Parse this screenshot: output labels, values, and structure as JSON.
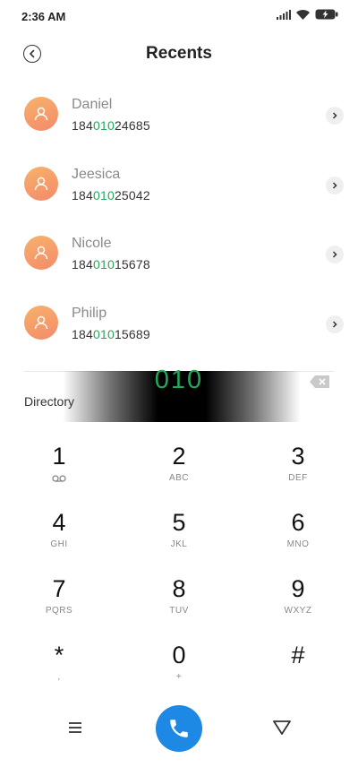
{
  "status_bar": {
    "time": "2:36 AM",
    "icons": [
      "signal-icon",
      "wifi-icon",
      "battery-charging-icon"
    ]
  },
  "header": {
    "title": "Recents",
    "back_icon": "back-circle-icon"
  },
  "recents": [
    {
      "name": "Daniel",
      "number_prefix": "184",
      "number_match": "010",
      "number_suffix": "24685"
    },
    {
      "name": "Jeesica",
      "number_prefix": "184",
      "number_match": "010",
      "number_suffix": "25042"
    },
    {
      "name": "Nicole",
      "number_prefix": "184",
      "number_match": "010",
      "number_suffix": "15678"
    },
    {
      "name": "Philip",
      "number_prefix": "184",
      "number_match": "010",
      "number_suffix": "15689"
    }
  ],
  "dialer": {
    "input": "010",
    "directory_label": "Directory",
    "match_color": "#22a85a"
  },
  "keypad": [
    {
      "digit": "1",
      "letters": "",
      "icon": "voicemail-icon"
    },
    {
      "digit": "2",
      "letters": "ABC"
    },
    {
      "digit": "3",
      "letters": "DEF"
    },
    {
      "digit": "4",
      "letters": "GHI"
    },
    {
      "digit": "5",
      "letters": "JKL"
    },
    {
      "digit": "6",
      "letters": "MNO"
    },
    {
      "digit": "7",
      "letters": "PQRS"
    },
    {
      "digit": "8",
      "letters": "TUV"
    },
    {
      "digit": "9",
      "letters": "WXYZ"
    },
    {
      "digit": "*",
      "letters": ","
    },
    {
      "digit": "0",
      "letters": "+"
    },
    {
      "digit": "#",
      "letters": ""
    }
  ],
  "bottom_bar": {
    "menu_icon": "menu-icon",
    "call_icon": "phone-icon",
    "hide_icon": "hide-keypad-icon",
    "call_color": "#1e88e5"
  }
}
